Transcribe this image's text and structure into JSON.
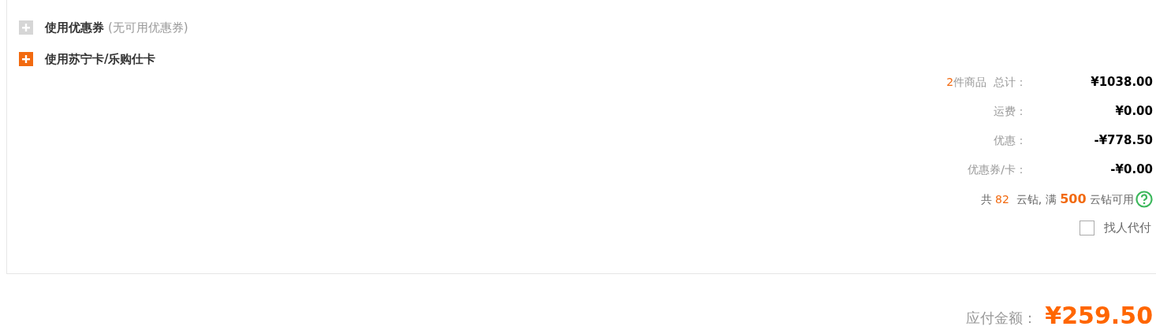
{
  "options": [
    {
      "label": "使用优惠券",
      "note": "(无可用优惠券)",
      "available": false
    },
    {
      "label": "使用苏宁卡/乐购仕卡",
      "available": true
    }
  ],
  "summary": {
    "count": "2",
    "count_label": "件商品  总计：",
    "rows": [
      {
        "label": "运费：",
        "value": "¥0.00"
      },
      {
        "label": "优惠：",
        "value": "-¥778.50"
      },
      {
        "label": "优惠券/卡：",
        "value": "-¥0.00"
      }
    ],
    "total": "¥1038.00"
  },
  "coins": {
    "prefix": "共",
    "count": "82",
    "middle": "云钻, 满",
    "threshold": "500",
    "suffix": "云钻可用"
  },
  "pay_for_me": {
    "label": "找人代付",
    "checked": false
  },
  "payable": {
    "label": "应付金额：",
    "amount": "¥259.50"
  }
}
